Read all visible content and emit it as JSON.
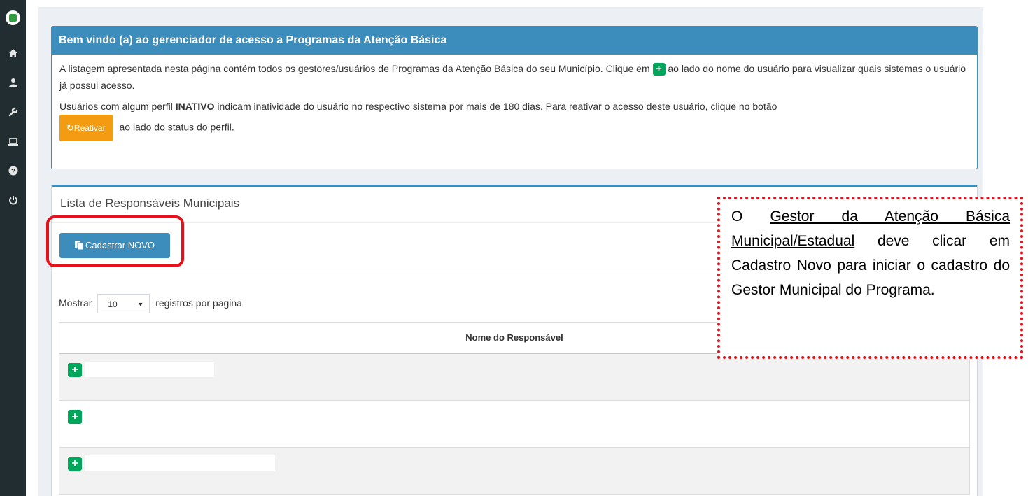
{
  "sidebar": {
    "icons": [
      "home-icon",
      "user-icon",
      "wrench-icon",
      "laptop-icon",
      "question-icon",
      "power-icon"
    ]
  },
  "welcome": {
    "title": "Bem vindo (a) ao gerenciador de acesso a Programas da Atenção Básica",
    "p1_before": "A listagem apresentada nesta página contém todos os gestores/usuários de Programas da Atenção Básica do seu Município. Clique em",
    "p1_after": "ao lado do nome do usuário para visualizar quais sistemas o usuário já possui acesso.",
    "p2_before": "Usuários com algum perfil",
    "p2_bold": "INATIVO",
    "p2_after": "indicam inatividade do usuário no respectivo sistema por mais de 180 dias. Para reativar o acesso deste usuário, clique no botão",
    "reactivate_label": "Reativar",
    "p2_end": "ao lado do status do perfil."
  },
  "list": {
    "title": "Lista de Responsáveis Municipais",
    "new_button": "Cadastrar NOVO",
    "show_label": "Mostrar",
    "page_size": "10",
    "per_page_label": "registros por pagina",
    "column_header": "Nome do Responsável",
    "rows": [
      {
        "name": ""
      },
      {
        "name": ""
      },
      {
        "name": ""
      }
    ]
  },
  "callout": {
    "text_before": "O",
    "underlined": "Gestor da Atenção Básica Municipal/Estadual",
    "text_after": "deve clicar em Cadastro Novo para iniciar o cadastro do Gestor Municipal do Programa."
  },
  "colors": {
    "sidebar": "#222d32",
    "primary": "#3c8dbc",
    "success": "#00a65a",
    "warning": "#f39c12",
    "annotation": "#e8101a"
  }
}
